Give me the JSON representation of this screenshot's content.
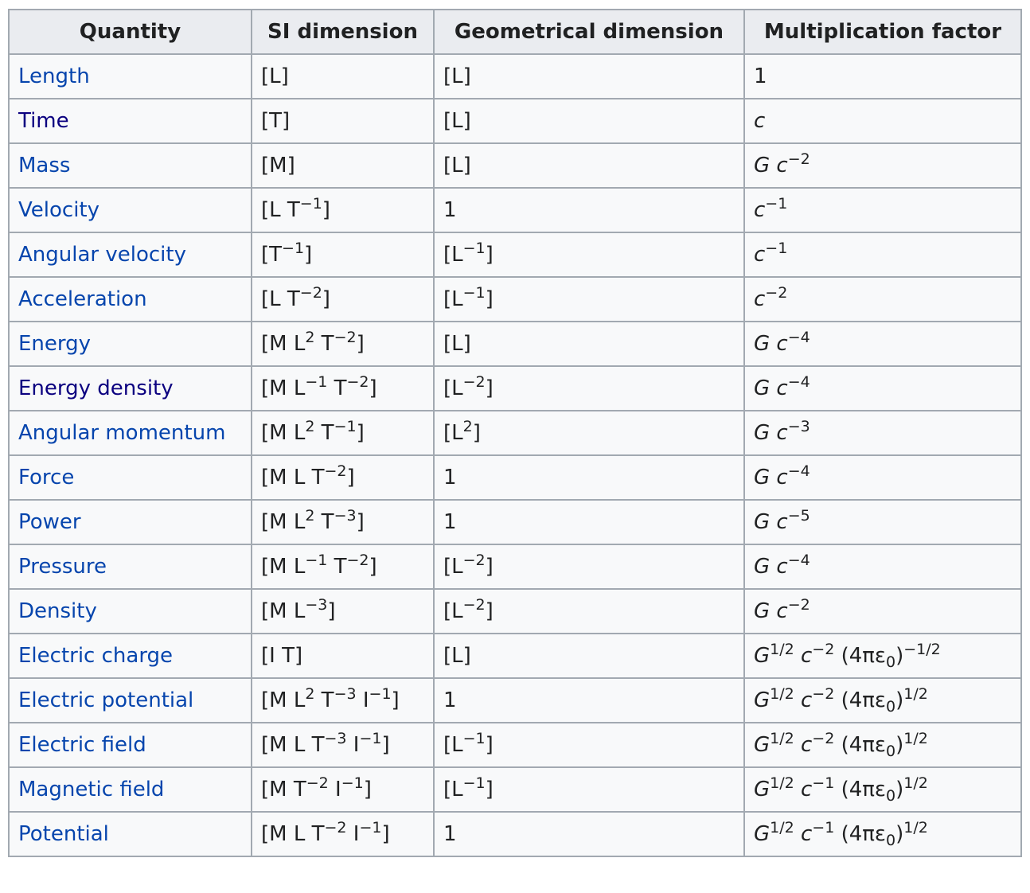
{
  "table": {
    "headers": [
      "Quantity",
      "SI dimension",
      "Geometrical dimension",
      "Multiplication factor"
    ],
    "link_colors": {
      "default": "#0645ad",
      "visited": "#0b0080"
    },
    "rows": [
      {
        "quantity": "Length",
        "visited": false,
        "si": [
          {
            "t": "[L]"
          }
        ],
        "geo": [
          {
            "t": "[L]"
          }
        ],
        "factor": [
          {
            "t": "1"
          }
        ]
      },
      {
        "quantity": "Time",
        "visited": true,
        "si": [
          {
            "t": "[T]"
          }
        ],
        "geo": [
          {
            "t": "[L]"
          }
        ],
        "factor": [
          {
            "t": "c",
            "i": true
          }
        ]
      },
      {
        "quantity": "Mass",
        "visited": false,
        "si": [
          {
            "t": "[M]"
          }
        ],
        "geo": [
          {
            "t": "[L]"
          }
        ],
        "factor": [
          {
            "t": "G",
            "i": true
          },
          {
            "t": " "
          },
          {
            "t": "c",
            "i": true
          },
          {
            "t": "−2",
            "sup": true
          }
        ]
      },
      {
        "quantity": "Velocity",
        "visited": false,
        "si": [
          {
            "t": "[L T"
          },
          {
            "t": "−1",
            "sup": true
          },
          {
            "t": "]"
          }
        ],
        "geo": [
          {
            "t": "1"
          }
        ],
        "factor": [
          {
            "t": "c",
            "i": true
          },
          {
            "t": "−1",
            "sup": true
          }
        ]
      },
      {
        "quantity": "Angular velocity",
        "visited": false,
        "si": [
          {
            "t": "[T"
          },
          {
            "t": "−1",
            "sup": true
          },
          {
            "t": "]"
          }
        ],
        "geo": [
          {
            "t": "[L"
          },
          {
            "t": "−1",
            "sup": true
          },
          {
            "t": "]"
          }
        ],
        "factor": [
          {
            "t": "c",
            "i": true
          },
          {
            "t": "−1",
            "sup": true
          }
        ]
      },
      {
        "quantity": "Acceleration",
        "visited": false,
        "si": [
          {
            "t": "[L T"
          },
          {
            "t": "−2",
            "sup": true
          },
          {
            "t": "]"
          }
        ],
        "geo": [
          {
            "t": "[L"
          },
          {
            "t": "−1",
            "sup": true
          },
          {
            "t": "]"
          }
        ],
        "factor": [
          {
            "t": "c",
            "i": true
          },
          {
            "t": "−2",
            "sup": true
          }
        ]
      },
      {
        "quantity": "Energy",
        "visited": false,
        "si": [
          {
            "t": "[M L"
          },
          {
            "t": "2",
            "sup": true
          },
          {
            "t": " T"
          },
          {
            "t": "−2",
            "sup": true
          },
          {
            "t": "]"
          }
        ],
        "geo": [
          {
            "t": "[L]"
          }
        ],
        "factor": [
          {
            "t": "G",
            "i": true
          },
          {
            "t": " "
          },
          {
            "t": "c",
            "i": true
          },
          {
            "t": "−4",
            "sup": true
          }
        ]
      },
      {
        "quantity": "Energy density",
        "visited": true,
        "si": [
          {
            "t": "[M L"
          },
          {
            "t": "−1",
            "sup": true
          },
          {
            "t": " T"
          },
          {
            "t": "−2",
            "sup": true
          },
          {
            "t": "]"
          }
        ],
        "geo": [
          {
            "t": "[L"
          },
          {
            "t": "−2",
            "sup": true
          },
          {
            "t": "]"
          }
        ],
        "factor": [
          {
            "t": "G",
            "i": true
          },
          {
            "t": " "
          },
          {
            "t": "c",
            "i": true
          },
          {
            "t": "−4",
            "sup": true
          }
        ]
      },
      {
        "quantity": "Angular momentum",
        "visited": false,
        "si": [
          {
            "t": "[M L"
          },
          {
            "t": "2",
            "sup": true
          },
          {
            "t": " T"
          },
          {
            "t": "−1",
            "sup": true
          },
          {
            "t": "]"
          }
        ],
        "geo": [
          {
            "t": "[L"
          },
          {
            "t": "2",
            "sup": true
          },
          {
            "t": "]"
          }
        ],
        "factor": [
          {
            "t": "G",
            "i": true
          },
          {
            "t": " "
          },
          {
            "t": "c",
            "i": true
          },
          {
            "t": "−3",
            "sup": true
          }
        ]
      },
      {
        "quantity": "Force",
        "visited": false,
        "si": [
          {
            "t": "[M L T"
          },
          {
            "t": "−2",
            "sup": true
          },
          {
            "t": "]"
          }
        ],
        "geo": [
          {
            "t": "1"
          }
        ],
        "factor": [
          {
            "t": "G",
            "i": true
          },
          {
            "t": " "
          },
          {
            "t": "c",
            "i": true
          },
          {
            "t": "−4",
            "sup": true
          }
        ]
      },
      {
        "quantity": "Power",
        "visited": false,
        "si": [
          {
            "t": "[M L"
          },
          {
            "t": "2",
            "sup": true
          },
          {
            "t": " T"
          },
          {
            "t": "−3",
            "sup": true
          },
          {
            "t": "]"
          }
        ],
        "geo": [
          {
            "t": "1"
          }
        ],
        "factor": [
          {
            "t": "G",
            "i": true
          },
          {
            "t": " "
          },
          {
            "t": "c",
            "i": true
          },
          {
            "t": "−5",
            "sup": true
          }
        ]
      },
      {
        "quantity": "Pressure",
        "visited": false,
        "si": [
          {
            "t": "[M L"
          },
          {
            "t": "−1",
            "sup": true
          },
          {
            "t": " T"
          },
          {
            "t": "−2",
            "sup": true
          },
          {
            "t": "]"
          }
        ],
        "geo": [
          {
            "t": "[L"
          },
          {
            "t": "−2",
            "sup": true
          },
          {
            "t": "]"
          }
        ],
        "factor": [
          {
            "t": "G",
            "i": true
          },
          {
            "t": " "
          },
          {
            "t": "c",
            "i": true
          },
          {
            "t": "−4",
            "sup": true
          }
        ]
      },
      {
        "quantity": "Density",
        "visited": false,
        "si": [
          {
            "t": "[M L"
          },
          {
            "t": "−3",
            "sup": true
          },
          {
            "t": "]"
          }
        ],
        "geo": [
          {
            "t": "[L"
          },
          {
            "t": "−2",
            "sup": true
          },
          {
            "t": "]"
          }
        ],
        "factor": [
          {
            "t": "G",
            "i": true
          },
          {
            "t": " "
          },
          {
            "t": "c",
            "i": true
          },
          {
            "t": "−2",
            "sup": true
          }
        ]
      },
      {
        "quantity": "Electric charge",
        "visited": false,
        "si": [
          {
            "t": "[I T]"
          }
        ],
        "geo": [
          {
            "t": "[L]"
          }
        ],
        "factor": [
          {
            "t": "G",
            "i": true
          },
          {
            "t": "1/2",
            "sup": true
          },
          {
            "t": " "
          },
          {
            "t": "c",
            "i": true
          },
          {
            "t": "−2",
            "sup": true
          },
          {
            "t": " (4πε"
          },
          {
            "t": "0",
            "sub": true
          },
          {
            "t": ")"
          },
          {
            "t": "−1/2",
            "sup": true
          }
        ]
      },
      {
        "quantity": "Electric potential",
        "visited": false,
        "si": [
          {
            "t": "[M L"
          },
          {
            "t": "2",
            "sup": true
          },
          {
            "t": " T"
          },
          {
            "t": "−3",
            "sup": true
          },
          {
            "t": " I"
          },
          {
            "t": "−1",
            "sup": true
          },
          {
            "t": "]"
          }
        ],
        "geo": [
          {
            "t": "1"
          }
        ],
        "factor": [
          {
            "t": "G",
            "i": true
          },
          {
            "t": "1/2",
            "sup": true
          },
          {
            "t": " "
          },
          {
            "t": "c",
            "i": true
          },
          {
            "t": "−2",
            "sup": true
          },
          {
            "t": " (4πε"
          },
          {
            "t": "0",
            "sub": true
          },
          {
            "t": ")"
          },
          {
            "t": "1/2",
            "sup": true
          }
        ]
      },
      {
        "quantity": "Electric field",
        "visited": false,
        "si": [
          {
            "t": "[M L T"
          },
          {
            "t": "−3",
            "sup": true
          },
          {
            "t": " I"
          },
          {
            "t": "−1",
            "sup": true
          },
          {
            "t": "]"
          }
        ],
        "geo": [
          {
            "t": "[L"
          },
          {
            "t": "−1",
            "sup": true
          },
          {
            "t": "]"
          }
        ],
        "factor": [
          {
            "t": "G",
            "i": true
          },
          {
            "t": "1/2",
            "sup": true
          },
          {
            "t": " "
          },
          {
            "t": "c",
            "i": true
          },
          {
            "t": "−2",
            "sup": true
          },
          {
            "t": " (4πε"
          },
          {
            "t": "0",
            "sub": true
          },
          {
            "t": ")"
          },
          {
            "t": "1/2",
            "sup": true
          }
        ]
      },
      {
        "quantity": "Magnetic field",
        "visited": false,
        "si": [
          {
            "t": "[M T"
          },
          {
            "t": "−2",
            "sup": true
          },
          {
            "t": " I"
          },
          {
            "t": "−1",
            "sup": true
          },
          {
            "t": "]"
          }
        ],
        "geo": [
          {
            "t": "[L"
          },
          {
            "t": "−1",
            "sup": true
          },
          {
            "t": "]"
          }
        ],
        "factor": [
          {
            "t": "G",
            "i": true
          },
          {
            "t": "1/2",
            "sup": true
          },
          {
            "t": " "
          },
          {
            "t": "c",
            "i": true
          },
          {
            "t": "−1",
            "sup": true
          },
          {
            "t": " (4πε"
          },
          {
            "t": "0",
            "sub": true
          },
          {
            "t": ")"
          },
          {
            "t": "1/2",
            "sup": true
          }
        ]
      },
      {
        "quantity": "Potential",
        "visited": false,
        "si": [
          {
            "t": "[M L T"
          },
          {
            "t": "−2",
            "sup": true
          },
          {
            "t": " I"
          },
          {
            "t": "−1",
            "sup": true
          },
          {
            "t": "]"
          }
        ],
        "geo": [
          {
            "t": "1"
          }
        ],
        "factor": [
          {
            "t": "G",
            "i": true
          },
          {
            "t": "1/2",
            "sup": true
          },
          {
            "t": " "
          },
          {
            "t": "c",
            "i": true
          },
          {
            "t": "−1",
            "sup": true
          },
          {
            "t": " (4πε"
          },
          {
            "t": "0",
            "sub": true
          },
          {
            "t": ")"
          },
          {
            "t": "1/2",
            "sup": true
          }
        ]
      }
    ]
  }
}
